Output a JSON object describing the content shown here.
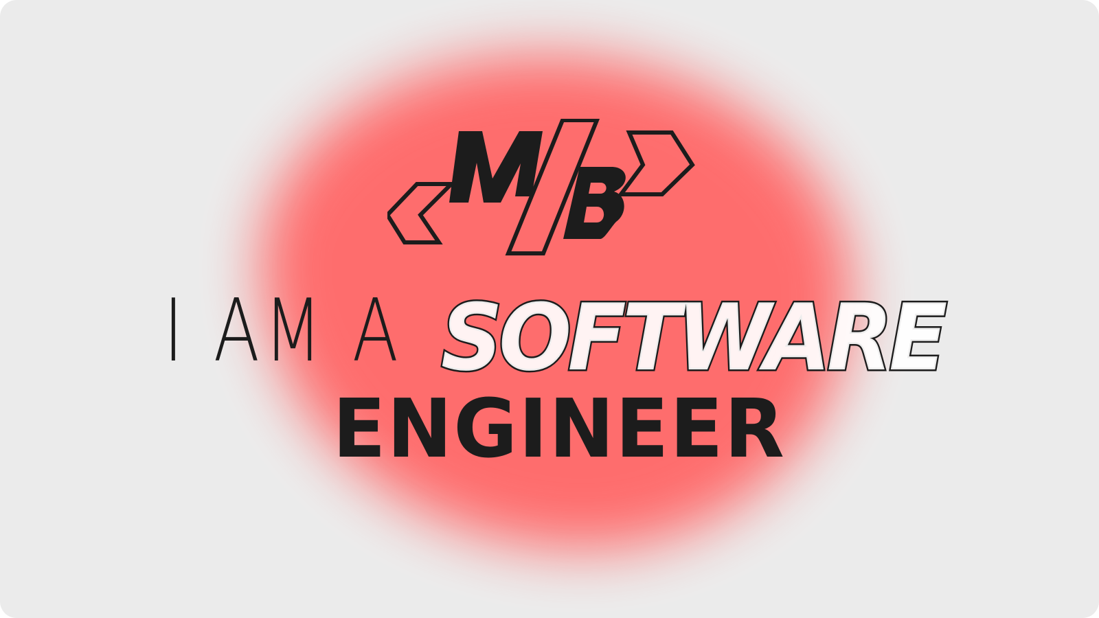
{
  "brand": {
    "logo_name": "MB-monogram-logo",
    "logo_text": "MB"
  },
  "hero": {
    "line1_prefix": "I AM A ",
    "line1_highlight": "SOFTWARE",
    "line2": "ENGINEER"
  },
  "colors": {
    "background": "#ebebeb",
    "accent_blob": "#ff6b6b",
    "text": "#1c1c1c",
    "outline_fill": "#ffffff"
  }
}
